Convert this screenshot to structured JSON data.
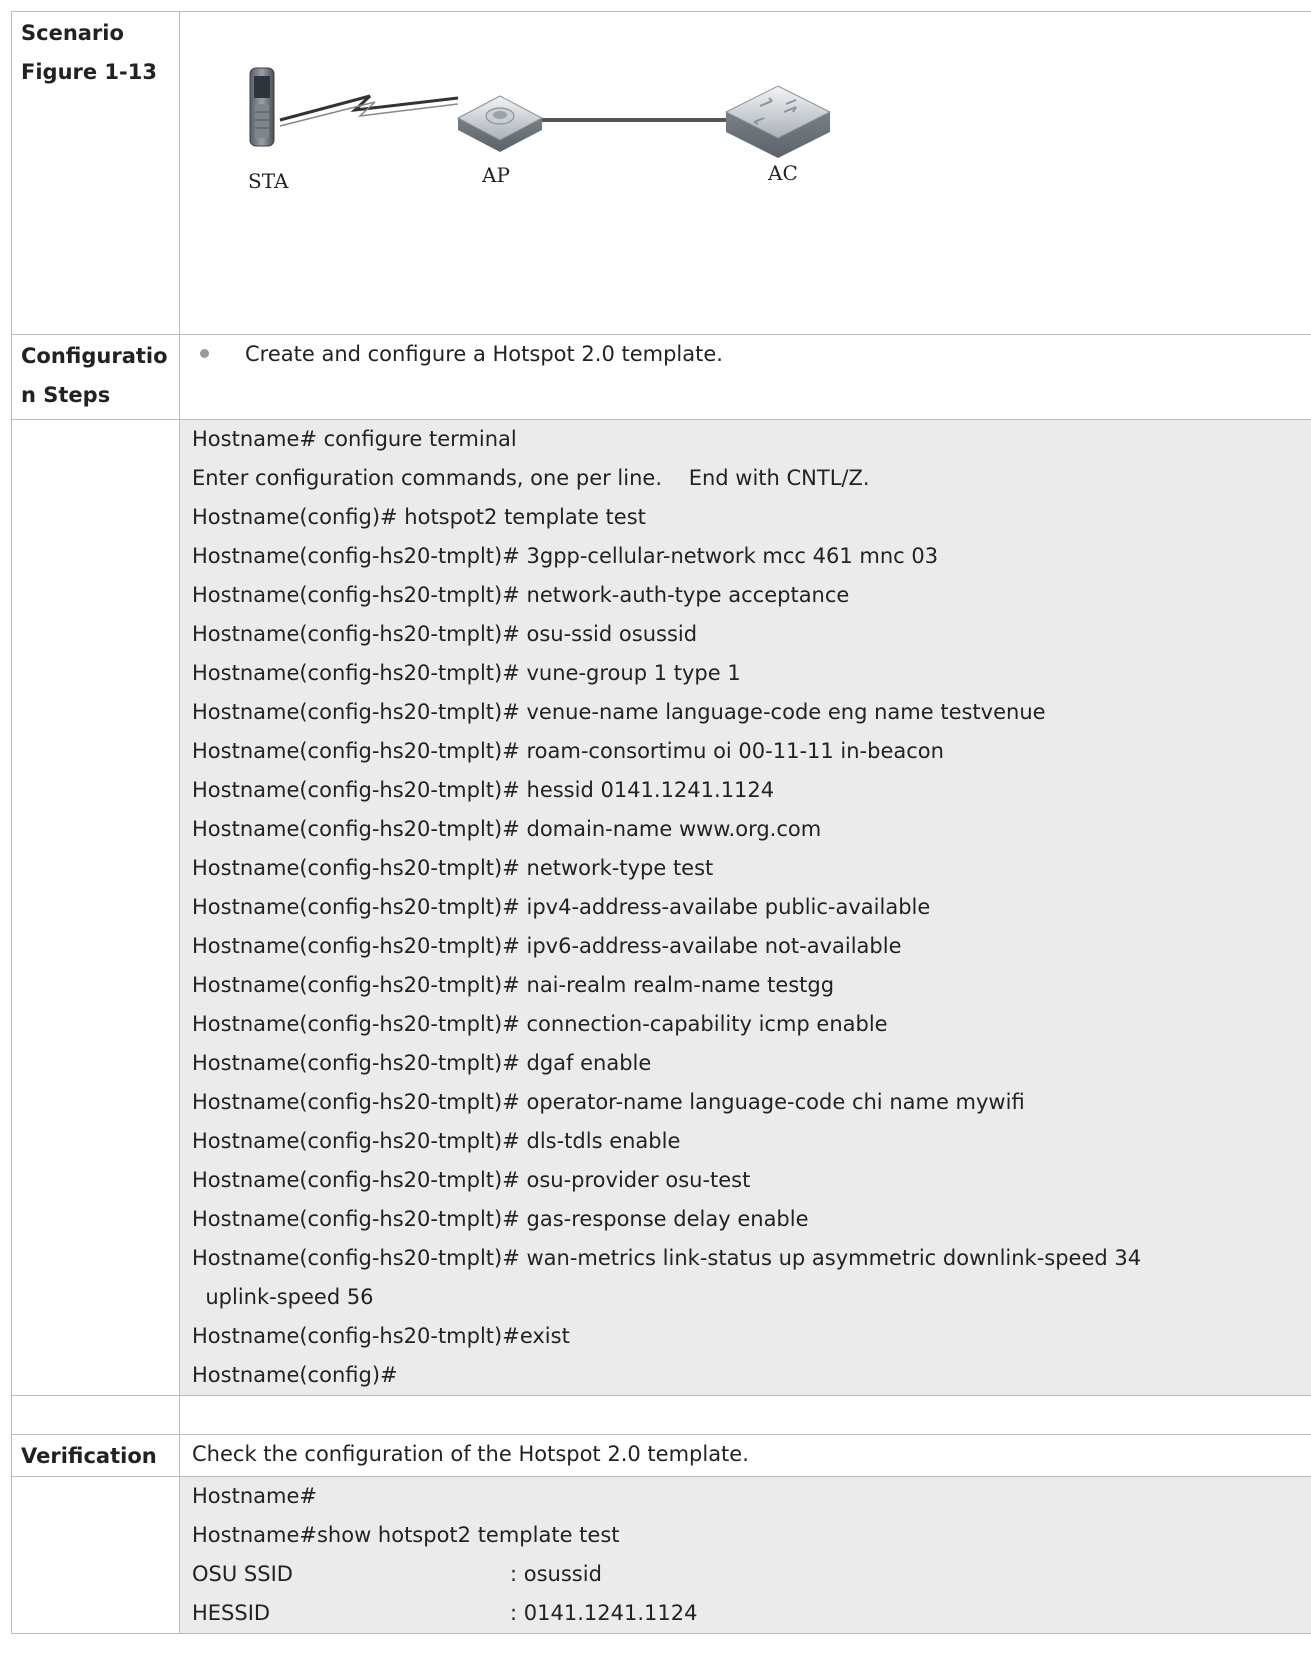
{
  "scenario": {
    "labels": [
      "Scenario",
      "Figure 1-13"
    ],
    "devices": {
      "sta": "STA",
      "ap": "AP",
      "ac": "AC"
    }
  },
  "config_steps": {
    "labels": [
      "Configuratio",
      "n Steps"
    ],
    "bullet": "Create and configure a Hotspot 2.0 template.",
    "code": [
      "Hostname# configure terminal",
      "Enter configuration commands, one per line.    End with CNTL/Z.",
      "Hostname(config)# hotspot2 template test",
      "Hostname(config-hs20-tmplt)# 3gpp-cellular-network mcc 461 mnc 03",
      "Hostname(config-hs20-tmplt)# network-auth-type acceptance",
      "Hostname(config-hs20-tmplt)# osu-ssid osussid",
      "Hostname(config-hs20-tmplt)# vune-group 1 type 1",
      "Hostname(config-hs20-tmplt)# venue-name language-code eng name testvenue",
      "Hostname(config-hs20-tmplt)# roam-consortimu oi 00-11-11 in-beacon",
      "Hostname(config-hs20-tmplt)# hessid 0141.1241.1124",
      "Hostname(config-hs20-tmplt)# domain-name www.org.com",
      "Hostname(config-hs20-tmplt)# network-type test",
      "Hostname(config-hs20-tmplt)# ipv4-address-availabe public-available",
      "Hostname(config-hs20-tmplt)# ipv6-address-availabe not-available",
      "Hostname(config-hs20-tmplt)# nai-realm realm-name testgg",
      "Hostname(config-hs20-tmplt)# connection-capability icmp enable",
      "Hostname(config-hs20-tmplt)# dgaf enable",
      "Hostname(config-hs20-tmplt)# operator-name language-code chi name mywifi",
      "Hostname(config-hs20-tmplt)# dls-tdls enable",
      "Hostname(config-hs20-tmplt)# osu-provider osu-test",
      "Hostname(config-hs20-tmplt)# gas-response delay enable",
      "Hostname(config-hs20-tmplt)# wan-metrics link-status up asymmetric downlink-speed 34",
      "  uplink-speed 56",
      "Hostname(config-hs20-tmplt)#exist",
      "Hostname(config)#"
    ]
  },
  "verification": {
    "label": "Verification",
    "text": "Check the configuration of the Hotspot 2.0 template.",
    "code": [
      "Hostname#",
      "Hostname#show hotspot2 template test"
    ],
    "kv": [
      {
        "key": "OSU SSID",
        "value": ": osussid"
      },
      {
        "key": "HESSID",
        "value": ": 0141.1241.1124"
      }
    ]
  }
}
